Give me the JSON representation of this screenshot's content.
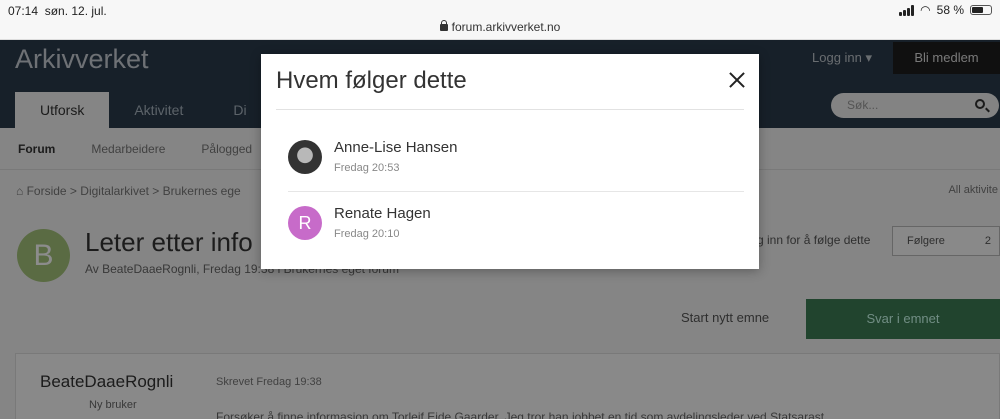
{
  "status": {
    "time": "07:14",
    "date": "søn. 12. jul.",
    "battery": "58 %",
    "url": "forum.arkivverket.no"
  },
  "header": {
    "brand": "Arkivverket",
    "login": "Logg inn ▾",
    "join": "Bli medlem",
    "tabs": [
      "Utforsk",
      "Aktivitet",
      "Di"
    ],
    "search_placeholder": "Søk..."
  },
  "subnav": [
    "Forum",
    "Medarbeidere",
    "Pålogged"
  ],
  "breadcrumb": "⌂ Forside  >  Digitalarkivet  >  Brukernes ege",
  "all_activity": "All aktivite",
  "topic": {
    "avatar_letter": "B",
    "title": "Leter etter info",
    "byline": "Av BeateDaaeRognli, Fredag 19:38 i Brukernes eget forum",
    "follow_text": "g inn for å følge dette",
    "followers_label": "Følgere",
    "followers_count": "2"
  },
  "actions": {
    "start": "Start nytt emne",
    "reply": "Svar i emnet"
  },
  "post": {
    "author": "BeateDaaeRognli",
    "role": "Ny bruker",
    "posted": "Skrevet Fredag 19:38",
    "body": "Forsøker å finne informasjon om Torleif Eide Gaarder. Jeg tror han jobbet en tid som avdelingsleder ved Statsarast"
  },
  "modal": {
    "title": "Hvem følger dette",
    "followers": [
      {
        "name": "Anne-Lise Hansen",
        "time": "Fredag 20:53",
        "initial": ""
      },
      {
        "name": "Renate Hagen",
        "time": "Fredag 20:10",
        "initial": "R"
      }
    ]
  },
  "colors": {
    "header_bg": "#2a3b4c",
    "reply_bg": "#3d7d55",
    "avatar_r": "#c76bc9"
  }
}
